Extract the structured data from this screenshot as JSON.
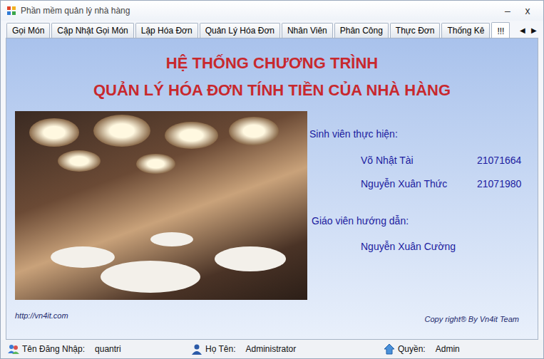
{
  "window": {
    "title": "Phần mềm quản lý nhà hàng",
    "controls": [
      "–",
      "x"
    ]
  },
  "tabs": [
    {
      "label": "Gọi Món",
      "selected": false
    },
    {
      "label": "Cập Nhật Gọi Món",
      "selected": false
    },
    {
      "label": "Lập Hóa Đơn",
      "selected": false
    },
    {
      "label": "Quản Lý Hóa Đơn",
      "selected": false
    },
    {
      "label": "Nhân Viên",
      "selected": false
    },
    {
      "label": "Phân Công",
      "selected": false
    },
    {
      "label": "Thực Đơn",
      "selected": false
    },
    {
      "label": "Thống Kê",
      "selected": false
    },
    {
      "label": "!!!",
      "selected": true
    }
  ],
  "tab_scroll": [
    "◀",
    "▶"
  ],
  "heading": [
    "HỆ THỐNG CHƯƠNG TRÌNH",
    "QUẢN LÝ HÓA ĐƠN TÍNH TIỀN CỦA NHÀ HÀNG"
  ],
  "credits": {
    "students_label": "Sinh viên thực hiện:",
    "students": [
      {
        "name": "Võ Nhật Tài",
        "id": "21071664"
      },
      {
        "name": "Nguyễn Xuân Thức",
        "id": "21071980"
      }
    ],
    "advisor_label": "Giáo viên hướng dẫn:",
    "advisor": "Nguyễn Xuân Cường"
  },
  "footer": {
    "url": "http://vn4it.com",
    "copyright": "Copy right® By Vn4it Team"
  },
  "status_bar": [
    {
      "label": "Tên Đăng Nhập:",
      "value": "quantri"
    },
    {
      "label": "Họ Tên:",
      "value": "Administrator"
    },
    {
      "label": "Quyền:",
      "value": "Admin"
    }
  ]
}
